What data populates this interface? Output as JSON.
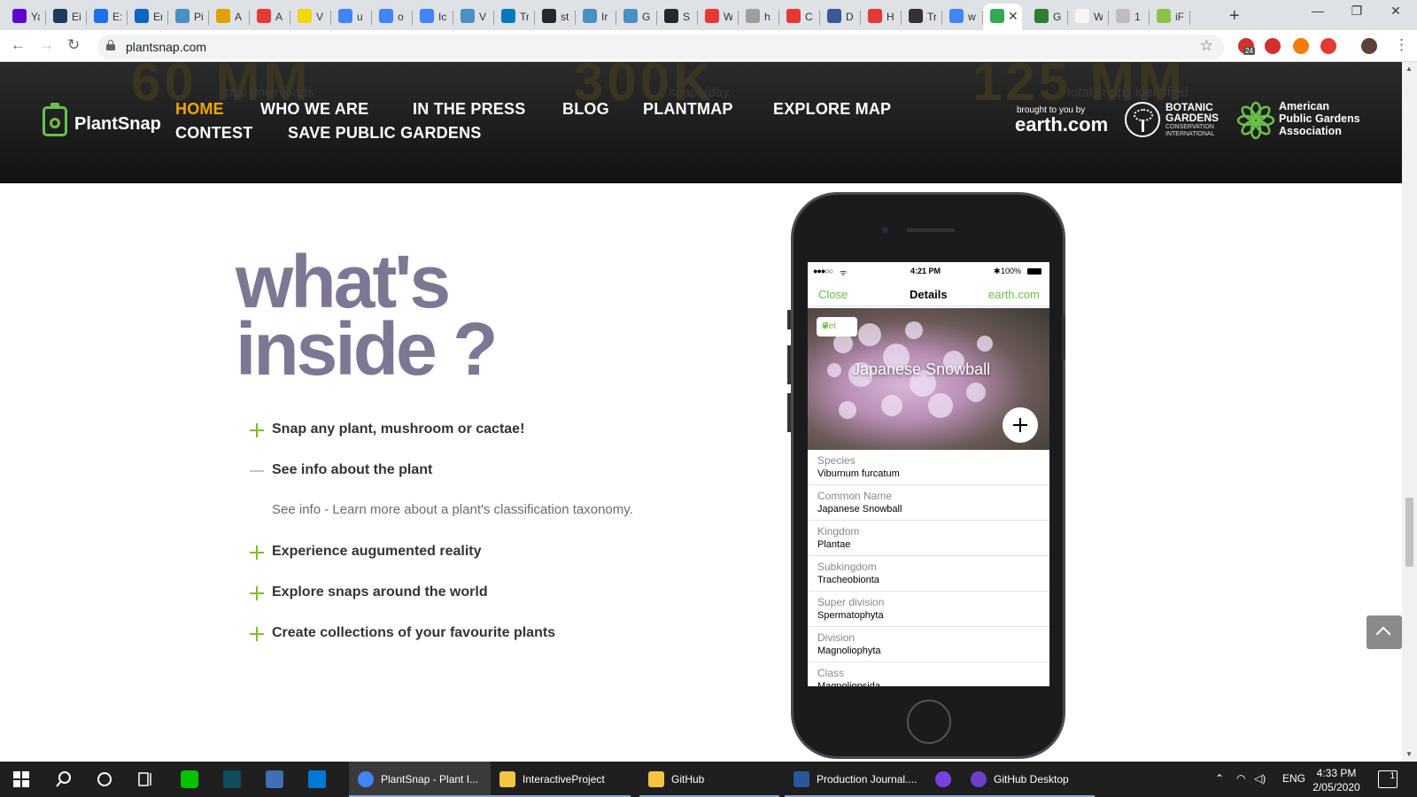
{
  "browser": {
    "tabs": [
      {
        "title": "Ya",
        "favicon_color": "#6001d2",
        "fav_icon": "yahoo-mail-icon"
      },
      {
        "title": "Ei",
        "favicon_color": "#1e3a5f",
        "fav_icon": "ei-icon"
      },
      {
        "title": "E:",
        "favicon_color": "#1a73e8",
        "fav_icon": "doc-icon"
      },
      {
        "title": "Er",
        "favicon_color": "#0a66c2",
        "fav_icon": "outlook-icon"
      },
      {
        "title": "Pi",
        "favicon_color": "#4a90c2",
        "fav_icon": "snowflake-icon"
      },
      {
        "title": "A",
        "favicon_color": "#e0a100",
        "fav_icon": "chrome-colored-icon"
      },
      {
        "title": "A",
        "favicon_color": "#e53935",
        "fav_icon": "s-icon"
      },
      {
        "title": "V",
        "favicon_color": "#f2d700",
        "fav_icon": "d-icon"
      },
      {
        "title": "u",
        "favicon_color": "#4285f4",
        "fav_icon": "google-icon"
      },
      {
        "title": "o",
        "favicon_color": "#4285f4",
        "fav_icon": "google-icon"
      },
      {
        "title": "Ic",
        "favicon_color": "#4285f4",
        "fav_icon": "google-icon"
      },
      {
        "title": "V",
        "favicon_color": "#4a90c2",
        "fav_icon": "snowflake-icon"
      },
      {
        "title": "Tr",
        "favicon_color": "#0079bf",
        "fav_icon": "trello-icon"
      },
      {
        "title": "st",
        "favicon_color": "#24292e",
        "fav_icon": "github-icon"
      },
      {
        "title": "Ir",
        "favicon_color": "#4a90c2",
        "fav_icon": "snowflake-icon"
      },
      {
        "title": "G",
        "favicon_color": "#4a90c2",
        "fav_icon": "snowflake-icon"
      },
      {
        "title": "S",
        "favicon_color": "#24292e",
        "fav_icon": "github-icon"
      },
      {
        "title": "W",
        "favicon_color": "#e53935",
        "fav_icon": "bird-icon"
      },
      {
        "title": "h",
        "favicon_color": "#9e9e9e",
        "fav_icon": "circle-icon"
      },
      {
        "title": "C",
        "favicon_color": "#e53935",
        "fav_icon": "bird-icon"
      },
      {
        "title": "D",
        "favicon_color": "#3b5998",
        "fav_icon": "d-box-icon"
      },
      {
        "title": "H",
        "favicon_color": "#e53935",
        "fav_icon": "bird-icon"
      },
      {
        "title": "Tr",
        "favicon_color": "#333333",
        "fav_icon": "x-circle-icon"
      },
      {
        "title": "w",
        "favicon_color": "#4285f4",
        "fav_icon": "google-icon"
      },
      {
        "title": "",
        "favicon_color": "#34a853",
        "fav_icon": "plantsnap-icon",
        "active": true
      },
      {
        "title": "G",
        "favicon_color": "#2e7d32",
        "fav_icon": "leaf-icon"
      },
      {
        "title": "W",
        "favicon_color": "#f5f5f5",
        "fav_icon": "daisy-icon"
      },
      {
        "title": "1",
        "favicon_color": "#bdbdbd",
        "fav_icon": "circle-icon"
      },
      {
        "title": "iF",
        "favicon_color": "#8bc34a",
        "fav_icon": "image-icon"
      }
    ],
    "new_tab": "+",
    "window_controls": {
      "minimize": "—",
      "restore": "❐",
      "close": "✕"
    },
    "nav": {
      "back": "←",
      "forward": "→",
      "reload": "↻"
    },
    "url": "plantsnap.com",
    "bookmark_star": "☆",
    "extensions": [
      {
        "name": "adblock-icon",
        "color": "#d32f2f",
        "badge": "24"
      },
      {
        "name": "lastpass-icon",
        "color": "#d32f2f"
      },
      {
        "name": "honey-icon",
        "color": "#f57c00"
      },
      {
        "name": "shield-icon",
        "color": "#e53935"
      },
      {
        "name": "profile-avatar",
        "color": "#5d4037"
      }
    ],
    "menu": "⋮"
  },
  "site": {
    "ghost_stats": [
      {
        "value": "60 MM",
        "label": "total downloads"
      },
      {
        "value": "300K",
        "label": "snaps/day"
      },
      {
        "value": "125 MM",
        "label": "total snaps identified"
      }
    ],
    "logo_text": "PlantSnap",
    "nav": [
      {
        "label": "HOME",
        "active": true
      },
      {
        "label": "WHO WE ARE"
      },
      {
        "label": "IN THE PRESS"
      },
      {
        "label": "BLOG"
      },
      {
        "label": "PLANTMAP"
      },
      {
        "label": "EXPLORE MAP"
      },
      {
        "label": "CONTEST"
      },
      {
        "label": "SAVE PUBLIC GARDENS"
      }
    ],
    "accent_color": "#f0a500",
    "partners": {
      "earth_small": "brought to you by",
      "earth_big": "earth.com",
      "bgci_line1": "BOTANIC",
      "bgci_line2": "GARDENS",
      "bgci_line3": "CONSERVATION",
      "bgci_line4": "INTERNATIONAL",
      "apga_line1": "American",
      "apga_line2": "Public Gardens",
      "apga_line3": "Association"
    }
  },
  "content": {
    "headline_line1": "what's",
    "headline_line2": "inside ?",
    "faq": [
      {
        "question": "Snap any plant, mushroom or cactae!",
        "expanded": false
      },
      {
        "question": "See info about the plant",
        "expanded": true,
        "answer": "See info - Learn more about a plant's classification taxonomy."
      },
      {
        "question": "Experience augumented reality",
        "expanded": false
      },
      {
        "question": "Explore snaps around the world",
        "expanded": false
      },
      {
        "question": "Create collections of your favourite plants",
        "expanded": false
      }
    ]
  },
  "phone": {
    "status": {
      "signal": "●●●○○",
      "wifi": "ᯤ",
      "time": "4:21 PM",
      "bluetooth": "✱",
      "battery": "100%"
    },
    "nav": {
      "close": "Close",
      "title": "Details",
      "source": "earth.com"
    },
    "get_label": "Get",
    "plant_name": "Japanese Snowball",
    "taxonomy": [
      {
        "key": "Species",
        "value": "Viburnum furcatum"
      },
      {
        "key": "Common Name",
        "value": "Japanese Snowball"
      },
      {
        "key": "Kingdom",
        "value": "Plantae"
      },
      {
        "key": "Subkingdom",
        "value": "Tracheobionta"
      },
      {
        "key": "Super division",
        "value": "Spermatophyta"
      },
      {
        "key": "Division",
        "value": "Magnoliophyta"
      },
      {
        "key": "Class",
        "value": "Magnoliopsida"
      }
    ]
  },
  "taskbar": {
    "apps": [
      {
        "label": "PlantSnap - Plant I...",
        "color": "#4285f4",
        "active": true,
        "icon": "chrome-icon"
      },
      {
        "label": "InteractiveProject",
        "color": "#f4c542",
        "icon": "folder-icon"
      },
      {
        "label": "GitHub",
        "color": "#f4c542",
        "icon": "folder-icon"
      },
      {
        "label": "Production Journal....",
        "color": "#2b579a",
        "icon": "word-icon"
      },
      {
        "label": "",
        "color": "#7b3fe4",
        "icon": "tor-icon"
      },
      {
        "label": "GitHub Desktop",
        "color": "#6e40c9",
        "icon": "github-desktop-icon"
      }
    ],
    "language": "ENG",
    "time": "4:33 PM",
    "date": "2/05/2020",
    "notifications": "1"
  }
}
